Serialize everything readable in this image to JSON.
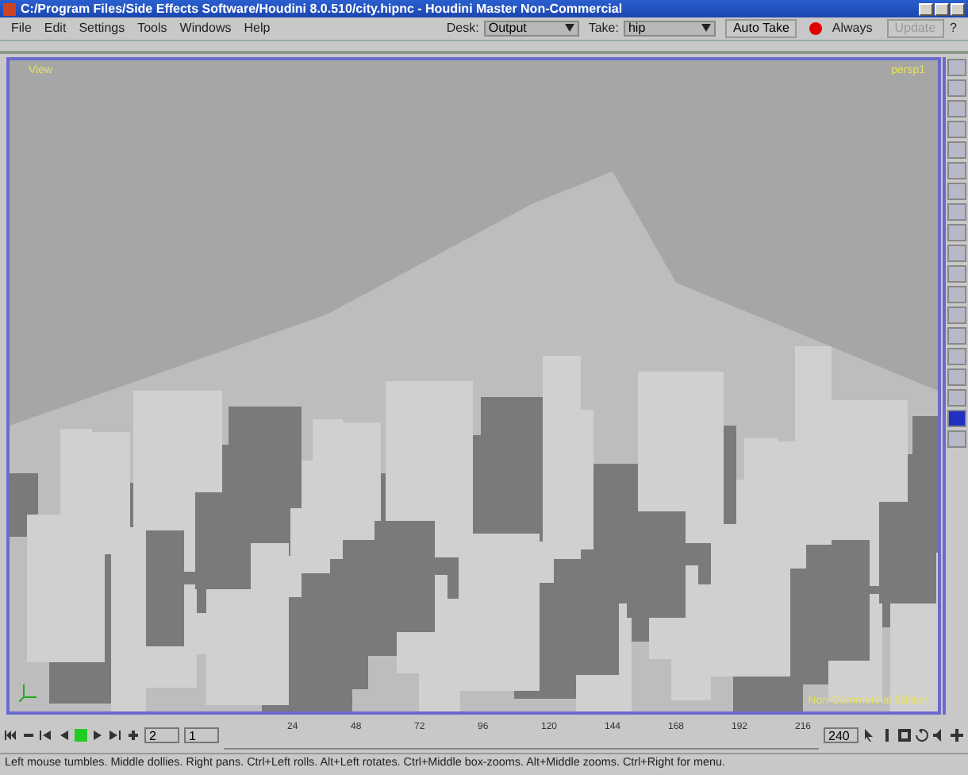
{
  "window": {
    "title": "C:/Program Files/Side Effects Software/Houdini 8.0.510/city.hipnc - Houdini Master Non-Commercial"
  },
  "menu": [
    "File",
    "Edit",
    "Settings",
    "Tools",
    "Windows",
    "Help"
  ],
  "desk": {
    "label": "Desk:",
    "value": "Output"
  },
  "take": {
    "label": "Take:",
    "value": "hip",
    "button": "Auto Take"
  },
  "update": {
    "mode": "Always",
    "button": "Update",
    "help": "?"
  },
  "viewport": {
    "view_label": "View",
    "camera": "persp1",
    "watermark": "Non-Commercial Edition"
  },
  "playbar": {
    "current_frame": "2",
    "start_frame": "1",
    "end_frame": "240",
    "ticks": [
      "24",
      "48",
      "72",
      "96",
      "120",
      "144",
      "168",
      "192",
      "216"
    ]
  },
  "status_bar": "Left mouse tumbles. Middle dollies. Right pans. Ctrl+Left rolls. Alt+Left rotates. Ctrl+Middle box-zooms. Alt+Middle zooms. Ctrl+Right for menu."
}
